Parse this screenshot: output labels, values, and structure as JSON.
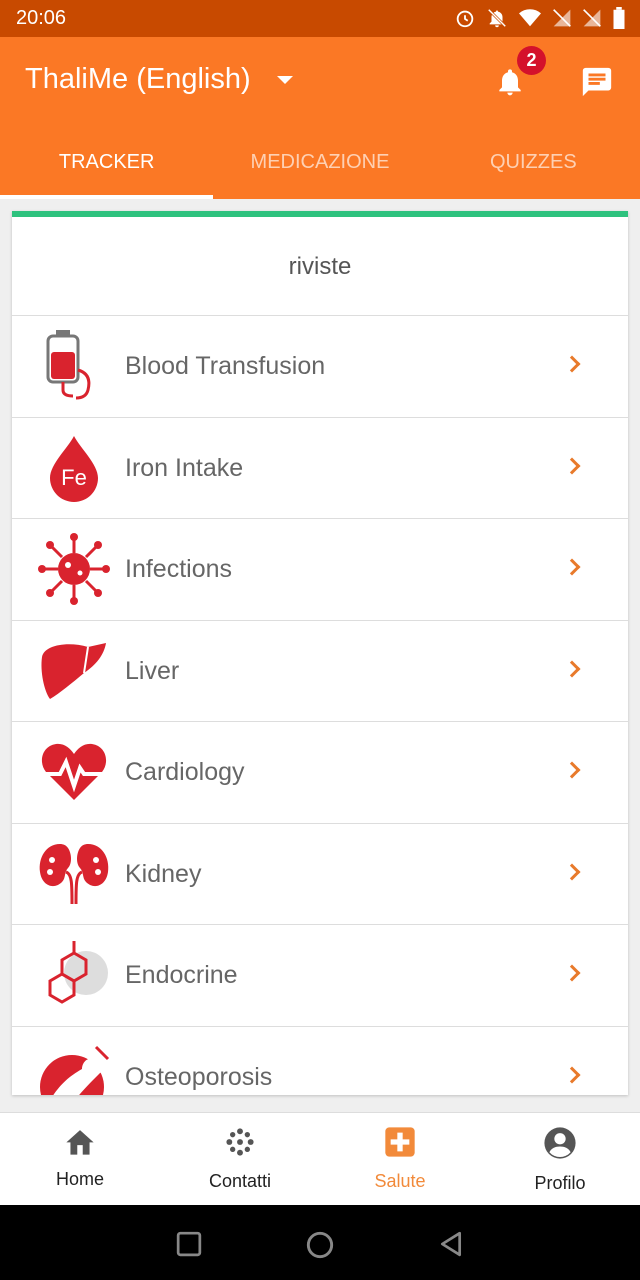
{
  "status": {
    "time": "20:06"
  },
  "appbar": {
    "title": "ThaliMe (English)",
    "badge": "2"
  },
  "tabs": [
    "TRACKER",
    "MEDICAZIONE",
    "QUIZZES"
  ],
  "card": {
    "header": "riviste",
    "items": [
      {
        "label": "Blood Transfusion",
        "icon": "blood-bag-icon"
      },
      {
        "label": "Iron Intake",
        "icon": "iron-drop-icon"
      },
      {
        "label": "Infections",
        "icon": "virus-icon"
      },
      {
        "label": "Liver",
        "icon": "liver-icon"
      },
      {
        "label": "Cardiology",
        "icon": "heart-pulse-icon"
      },
      {
        "label": "Kidney",
        "icon": "kidney-icon"
      },
      {
        "label": "Endocrine",
        "icon": "hexagon-molecule-icon"
      },
      {
        "label": "Osteoporosis",
        "icon": "bone-icon"
      }
    ]
  },
  "bottomnav": [
    {
      "label": "Home"
    },
    {
      "label": "Contatti"
    },
    {
      "label": "Salute"
    },
    {
      "label": "Profilo"
    }
  ],
  "colors": {
    "accent": "#fb7825",
    "statusbar": "#c84a00",
    "icon_red": "#d9232e",
    "progress": "#2ec27e"
  }
}
